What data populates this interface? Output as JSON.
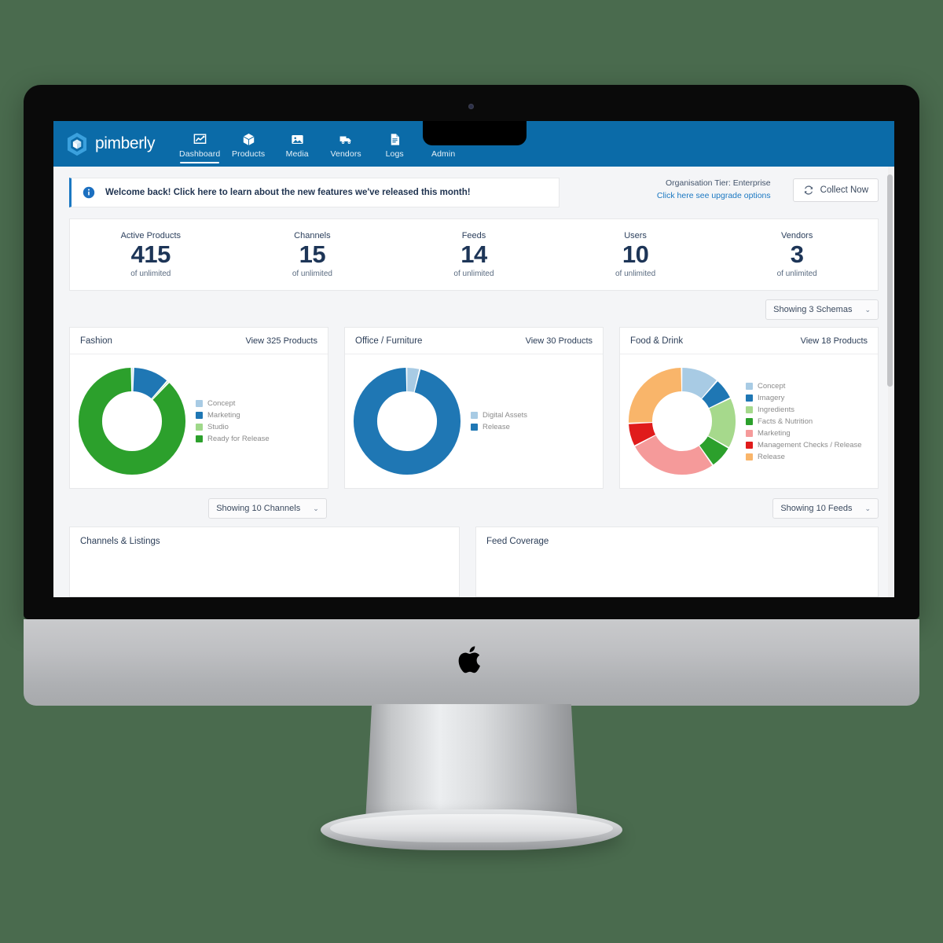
{
  "nav": {
    "brand": "pimberly",
    "items": [
      {
        "label": "Dashboard",
        "icon": "chart-line-icon",
        "active": true
      },
      {
        "label": "Products",
        "icon": "box-icon",
        "active": false
      },
      {
        "label": "Media",
        "icon": "image-icon",
        "active": false
      },
      {
        "label": "Vendors",
        "icon": "truck-icon",
        "active": false
      },
      {
        "label": "Logs",
        "icon": "document-icon",
        "active": false
      },
      {
        "label": "Admin",
        "icon": "gear-icon",
        "active": false
      }
    ]
  },
  "banner": {
    "icon": "info-icon",
    "message": "Welcome back! Click here to learn about the new features we've released this month!"
  },
  "tier": {
    "line": "Organisation Tier: Enterprise",
    "upgrade_link": "Click here see upgrade options",
    "collect_button": "Collect Now",
    "collect_icon": "refresh-icon"
  },
  "kpis": [
    {
      "label": "Active Products",
      "value": "415",
      "sub": "of unlimited"
    },
    {
      "label": "Channels",
      "value": "15",
      "sub": "of unlimited"
    },
    {
      "label": "Feeds",
      "value": "14",
      "sub": "of unlimited"
    },
    {
      "label": "Users",
      "value": "10",
      "sub": "of unlimited"
    },
    {
      "label": "Vendors",
      "value": "3",
      "sub": "of unlimited"
    }
  ],
  "dropdowns": {
    "schemas": "Showing 3 Schemas",
    "channels": "Showing 10 Channels",
    "feeds": "Showing 10 Feeds",
    "caret": "⌄"
  },
  "schema_cards": [
    {
      "title": "Fashion",
      "link": "View 325 Products"
    },
    {
      "title": "Office / Furniture",
      "link": "View 30 Products"
    },
    {
      "title": "Food & Drink",
      "link": "View 18 Products"
    }
  ],
  "bottom_panels": [
    {
      "title": "Channels & Listings"
    },
    {
      "title": "Feed Coverage"
    }
  ],
  "colors": {
    "nav_blue": "#0b6ba8",
    "accent_link": "#1b78c2",
    "kpi_value": "#1d3557",
    "page_bg": "#f4f5f7",
    "desktop_bg": "#4a6b4e"
  },
  "chart_data": [
    {
      "type": "pie",
      "title": "Fashion",
      "subtitle": "View 325 Products",
      "legend_position": "right",
      "labels": [
        "Concept",
        "Marketing",
        "Studio",
        "Ready for Release"
      ],
      "values": [
        0.6,
        11.0,
        0.6,
        87.8
      ],
      "colors": [
        "#a8cbe4",
        "#1f77b4",
        "#9fd88a",
        "#2ca02c"
      ]
    },
    {
      "type": "pie",
      "title": "Office / Furniture",
      "subtitle": "View 30 Products",
      "legend_position": "right",
      "labels": [
        "Digital Assets",
        "Release"
      ],
      "values": [
        4.0,
        96.0
      ],
      "colors": [
        "#a8cbe4",
        "#1f77b4"
      ]
    },
    {
      "type": "pie",
      "title": "Food & Drink",
      "subtitle": "View 18 Products",
      "legend_position": "right",
      "labels": [
        "Concept",
        "Imagery",
        "Ingredients",
        "Facts & Nutrition",
        "Marketing",
        "Management Checks / Release",
        "Release"
      ],
      "values": [
        11.5,
        6.5,
        15.5,
        7.0,
        27.0,
        7.0,
        25.5
      ],
      "colors": [
        "#a8cbe4",
        "#1f77b4",
        "#a6d98c",
        "#2ca02c",
        "#f59a9a",
        "#e01b1b",
        "#f9b56a"
      ]
    }
  ]
}
